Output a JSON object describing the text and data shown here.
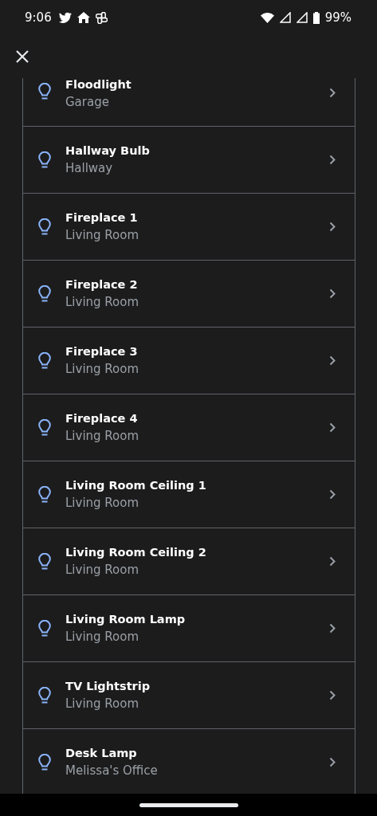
{
  "status_bar": {
    "time": "9:06",
    "battery": "99%"
  },
  "devices": [
    {
      "name": "Floodlight",
      "room": "Garage"
    },
    {
      "name": "Hallway Bulb",
      "room": "Hallway"
    },
    {
      "name": "Fireplace 1",
      "room": "Living Room"
    },
    {
      "name": "Fireplace 2",
      "room": "Living Room"
    },
    {
      "name": "Fireplace 3",
      "room": "Living Room"
    },
    {
      "name": "Fireplace 4",
      "room": "Living Room"
    },
    {
      "name": "Living Room Ceiling 1",
      "room": "Living Room"
    },
    {
      "name": "Living Room Ceiling 2",
      "room": "Living Room"
    },
    {
      "name": "Living Room Lamp",
      "room": "Living Room"
    },
    {
      "name": "TV Lightstrip",
      "room": "Living Room"
    },
    {
      "name": "Desk Lamp",
      "room": "Melissa's Office"
    }
  ]
}
